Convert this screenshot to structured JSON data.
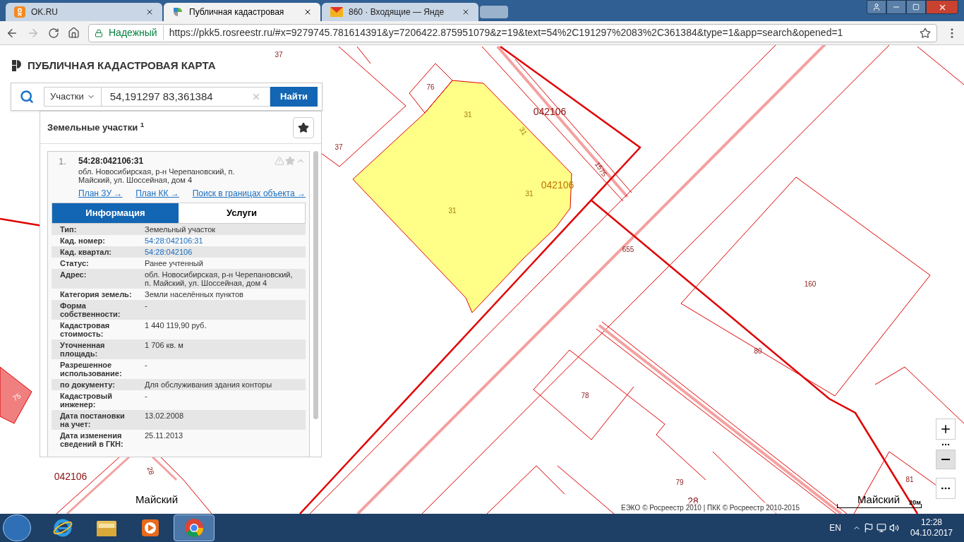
{
  "browser": {
    "tabs": [
      {
        "title": "OK.RU",
        "selected": false
      },
      {
        "title": "Публичная кадастровая",
        "selected": true
      },
      {
        "title": "860 · Входящие — Янде",
        "selected": false
      }
    ],
    "security": "Надежный",
    "url": "https://pkk5.rosreestr.ru/#x=9279745.781614391&y=7206422.875951079&z=19&text=54%2C191297%2083%2C361384&type=1&app=search&opened=1"
  },
  "app": {
    "title": "ПУБЛИЧНАЯ КАДАСТРОВАЯ КАРТА",
    "search": {
      "category": "Участки",
      "value": "54,191297 83,361384",
      "button": "Найти"
    },
    "results": {
      "heading": "Земельные участки $^{1}$",
      "item": {
        "number": "1.",
        "cadastral_number": "54:28:042106:31",
        "address": "обл. Новосибирская, р-н Черепановский, п. Майский, ул. Шоссейная, дом 4",
        "links": [
          "План ЗУ →",
          "План КК →",
          "Поиск в границах объекта →"
        ],
        "tabs": [
          {
            "label": "Информация",
            "selected": true
          },
          {
            "label": "Услуги",
            "selected": false
          }
        ],
        "rows": [
          {
            "label": "Тип:",
            "value": "Земельный участок",
            "link": false
          },
          {
            "label": "Кад. номер:",
            "value": "54:28:042106:31",
            "link": true
          },
          {
            "label": "Кад. квартал:",
            "value": "54:28:042106",
            "link": true
          },
          {
            "label": "Статус:",
            "value": "Ранее учтенный",
            "link": false
          },
          {
            "label": "Адрес:",
            "value": "обл. Новосибирская, р-н Черепановский, п. Майский, ул. Шоссейная, дом 4",
            "link": false
          },
          {
            "label": "Категория земель:",
            "value": "Земли населённых пунктов",
            "link": false
          },
          {
            "label": "Форма собственности:",
            "value": "-",
            "link": false
          },
          {
            "label": "Кадастровая стоимость:",
            "value": "1 440 119,90 руб.",
            "link": false
          },
          {
            "label": "Уточненная площадь:",
            "value": "1 706 кв. м",
            "link": false
          },
          {
            "label": "Разрешенное использование:",
            "value": "-",
            "link": false
          },
          {
            "label": "по документу:",
            "value": "Для обслуживания здания конторы",
            "link": false
          },
          {
            "label": "Кадастровый инженер:",
            "value": "-",
            "link": false
          },
          {
            "label": "Дата постановки на учет:",
            "value": "13.02.2008",
            "link": false
          },
          {
            "label": "Дата изменения сведений в ГКН:",
            "value": "25.11.2013",
            "link": false
          }
        ]
      }
    }
  },
  "map": {
    "labels": [
      {
        "text": "37",
        "kind": "parcel"
      },
      {
        "text": "76",
        "kind": "parcel"
      },
      {
        "text": "31",
        "kind": "selected"
      },
      {
        "text": "31",
        "kind": "selected"
      },
      {
        "text": "042106",
        "kind": "block"
      },
      {
        "text": "1575",
        "kind": "parcel"
      },
      {
        "text": "042106",
        "kind": "block_selected"
      },
      {
        "text": "31",
        "kind": "selected"
      },
      {
        "text": "31",
        "kind": "selected"
      },
      {
        "text": "37",
        "kind": "parcel"
      },
      {
        "text": "655",
        "kind": "parcel"
      },
      {
        "text": "160",
        "kind": "parcel"
      },
      {
        "text": "80",
        "kind": "parcel"
      },
      {
        "text": "78",
        "kind": "parcel"
      },
      {
        "text": "79",
        "kind": "parcel"
      },
      {
        "text": "28",
        "kind": "block"
      },
      {
        "text": "81",
        "kind": "parcel"
      },
      {
        "text": "75",
        "kind": "filled"
      },
      {
        "text": "28",
        "kind": "parcel"
      },
      {
        "text": "Майский",
        "kind": "place"
      },
      {
        "text": "Майский",
        "kind": "place"
      },
      {
        "text": "042106",
        "kind": "block"
      }
    ],
    "attribution": "ЕЭКО © Росреестр 2010 | ПКК © Росреестр 2010-2015",
    "scale": "20м"
  },
  "taskbar": {
    "apps": [
      {
        "selected": false
      },
      {
        "selected": false
      },
      {
        "selected": false
      },
      {
        "selected": true
      }
    ],
    "language": "EN",
    "time": "12:28",
    "date": "04.10.2017"
  }
}
